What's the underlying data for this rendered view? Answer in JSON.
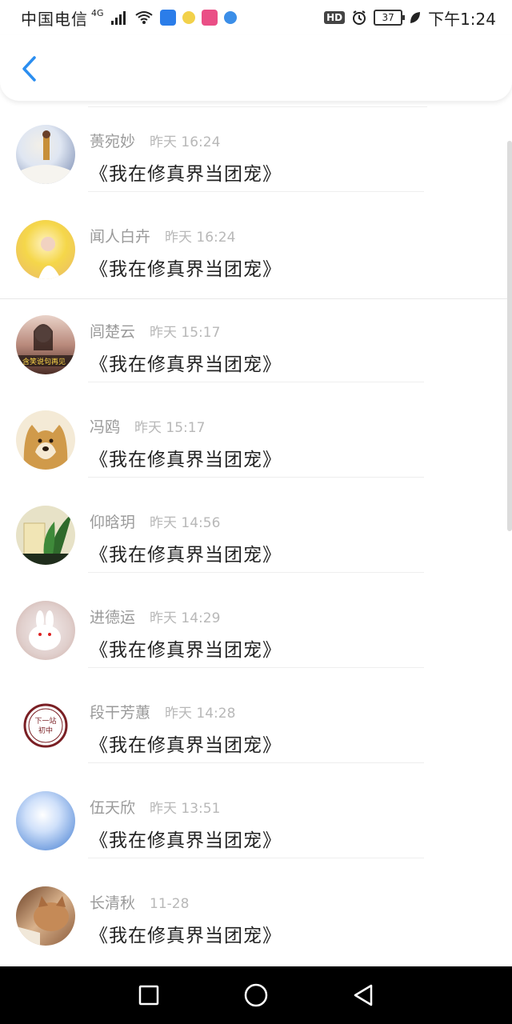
{
  "status_bar": {
    "carrier": "中国电信",
    "network": "4G",
    "battery": "37",
    "time": "下午1:24",
    "hd_label": "HD"
  },
  "header": {
    "back_icon": "chevron-left-icon",
    "accent": "#2b8ef0"
  },
  "comments": [
    {
      "name": "蒉宛妙",
      "time": "昨天 16:24",
      "text": "《我在修真界当团宠》",
      "avatar_colors": [
        "#6c7fa8",
        "#f2efe8"
      ]
    },
    {
      "name": "闻人白卉",
      "time": "昨天 16:24",
      "text": "《我在修真界当团宠》",
      "avatar_colors": [
        "#f5d74a",
        "#e9b96b"
      ]
    },
    {
      "name": "闾楚云",
      "time": "昨天 15:17",
      "text": "《我在修真界当团宠》",
      "avatar_colors": [
        "#4a2c25",
        "#f3d3c5"
      ],
      "avatar_caption": "含笑说句再见"
    },
    {
      "name": "冯鸥",
      "time": "昨天 15:17",
      "text": "《我在修真界当团宠》",
      "avatar_colors": [
        "#d09a4a",
        "#f6e9d2"
      ]
    },
    {
      "name": "仰晗玥",
      "time": "昨天 14:56",
      "text": "《我在修真界当团宠》",
      "avatar_colors": [
        "#2f6a2c",
        "#e7e2c7"
      ]
    },
    {
      "name": "进德运",
      "time": "昨天 14:29",
      "text": "《我在修真界当团宠》",
      "avatar_colors": [
        "#caa9a2",
        "#f3ecec"
      ]
    },
    {
      "name": "段干芳蕙",
      "time": "昨天 14:28",
      "text": "《我在修真界当团宠》",
      "avatar_colors": [
        "#7a1f24",
        "#ffffff"
      ],
      "avatar_caption": "下一站 初中"
    },
    {
      "name": "伍天欣",
      "time": "昨天 13:51",
      "text": "《我在修真界当团宠》",
      "avatar_colors": [
        "#3f7ad0",
        "#e7eefb"
      ]
    },
    {
      "name": "长清秋",
      "time": "11-28",
      "text": "《我在修真界当团宠》",
      "avatar_colors": [
        "#8a5a3a",
        "#d9b28c"
      ]
    }
  ],
  "nav": {
    "recent_icon": "square-icon",
    "home_icon": "circle-icon",
    "back_icon": "triangle-back-icon"
  }
}
